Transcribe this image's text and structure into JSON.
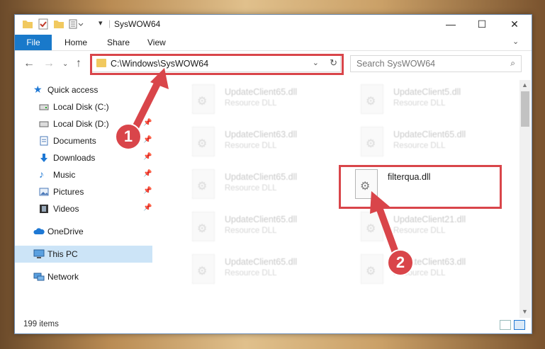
{
  "window": {
    "title": "SysWOW64",
    "controls": {
      "minimize": "—",
      "maximize": "☐",
      "close": "✕"
    }
  },
  "ribbon": {
    "tabs": [
      "File",
      "Home",
      "Share",
      "View"
    ]
  },
  "nav": {
    "address": "C:\\Windows\\SysWOW64",
    "search_placeholder": "Search SysWOW64"
  },
  "sidebar": {
    "items": [
      {
        "label": "Quick access",
        "icon": "star-icon",
        "pinned": false
      },
      {
        "label": "Local Disk (C:)",
        "icon": "drive-icon",
        "pinned": false
      },
      {
        "label": "Local Disk (D:)",
        "icon": "drive-icon",
        "pinned": true
      },
      {
        "label": "Documents",
        "icon": "documents-icon",
        "pinned": true
      },
      {
        "label": "Downloads",
        "icon": "download-icon",
        "pinned": true
      },
      {
        "label": "Music",
        "icon": "music-icon",
        "pinned": true
      },
      {
        "label": "Pictures",
        "icon": "pictures-icon",
        "pinned": true
      },
      {
        "label": "Videos",
        "icon": "video-icon",
        "pinned": true
      },
      {
        "label": "OneDrive",
        "icon": "cloud-icon",
        "pinned": false
      },
      {
        "label": "This PC",
        "icon": "computer-icon",
        "pinned": false,
        "selected": true
      },
      {
        "label": "Network",
        "icon": "network-icon",
        "pinned": false
      }
    ]
  },
  "files": [
    {
      "name": "UpdateClient65.dll",
      "type": "Resource DLL"
    },
    {
      "name": "UpdateClient5.dll",
      "type": "Resource DLL"
    },
    {
      "name": "UpdateClient63.dll",
      "type": "Resource DLL"
    },
    {
      "name": "UpdateClient65.dll",
      "type": "Resource DLL"
    },
    {
      "name": "UpdateClient65.dll",
      "type": "Resource DLL"
    },
    {
      "name": "filterqua.dll",
      "type": ""
    },
    {
      "name": "UpdateClient65.dll",
      "type": "Resource DLL"
    },
    {
      "name": "UpdateClient21.dll",
      "type": "Resource DLL"
    },
    {
      "name": "UpdateClient65.dll",
      "type": "Resource DLL"
    },
    {
      "name": "UpdateClient63.dll",
      "type": "Resource DLL"
    }
  ],
  "status": {
    "count": "199 items"
  },
  "annotations": {
    "step1": "1",
    "step2": "2",
    "color": "#d9454a"
  }
}
